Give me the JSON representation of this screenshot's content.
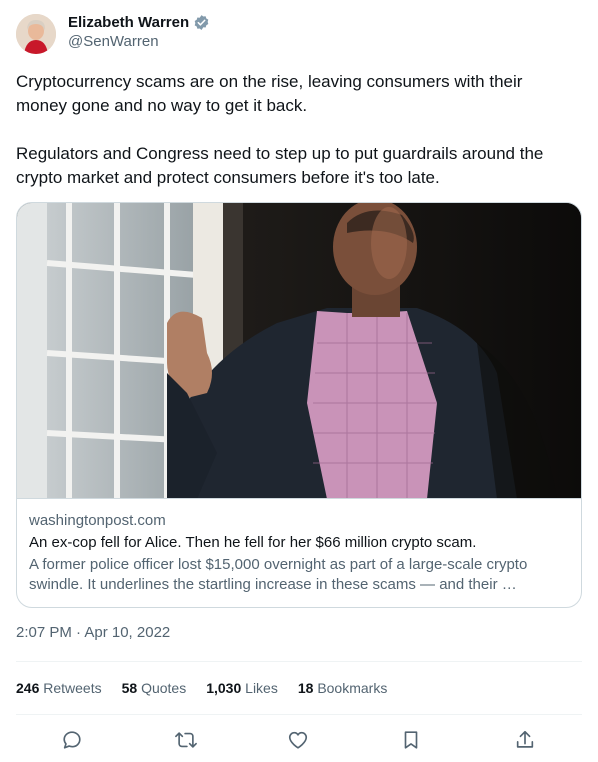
{
  "author": {
    "name": "Elizabeth Warren",
    "handle": "@SenWarren",
    "verified_icon": "verified-badge-icon"
  },
  "tweet": {
    "paragraphs": [
      "Cryptocurrency scams are on the rise, leaving consumers with their money gone and no way to get it back.",
      "Regulators and Congress need to step up to put guardrails around the crypto market and protect consumers before it's too late."
    ]
  },
  "card": {
    "domain": "washingtonpost.com",
    "title": "An ex-cop fell for Alice. Then he fell for her $66 million crypto scam.",
    "description": "A former police officer lost $15,000 overnight as part of a large-scale crypto swindle. It underlines the startling increase in these scams — and their …"
  },
  "timestamp": "2:07 PM · Apr 10, 2022",
  "stats": {
    "retweets_count": "246",
    "retweets_label": "Retweets",
    "quotes_count": "58",
    "quotes_label": "Quotes",
    "likes_count": "1,030",
    "likes_label": "Likes",
    "bookmarks_count": "18",
    "bookmarks_label": "Bookmarks"
  },
  "actions": [
    "reply-icon",
    "retweet-icon",
    "like-icon",
    "bookmark-icon",
    "share-icon"
  ],
  "colors": {
    "text": "#0f1419",
    "secondary": "#536471",
    "border": "#cfd9de",
    "verified_badge": "#829aab"
  }
}
